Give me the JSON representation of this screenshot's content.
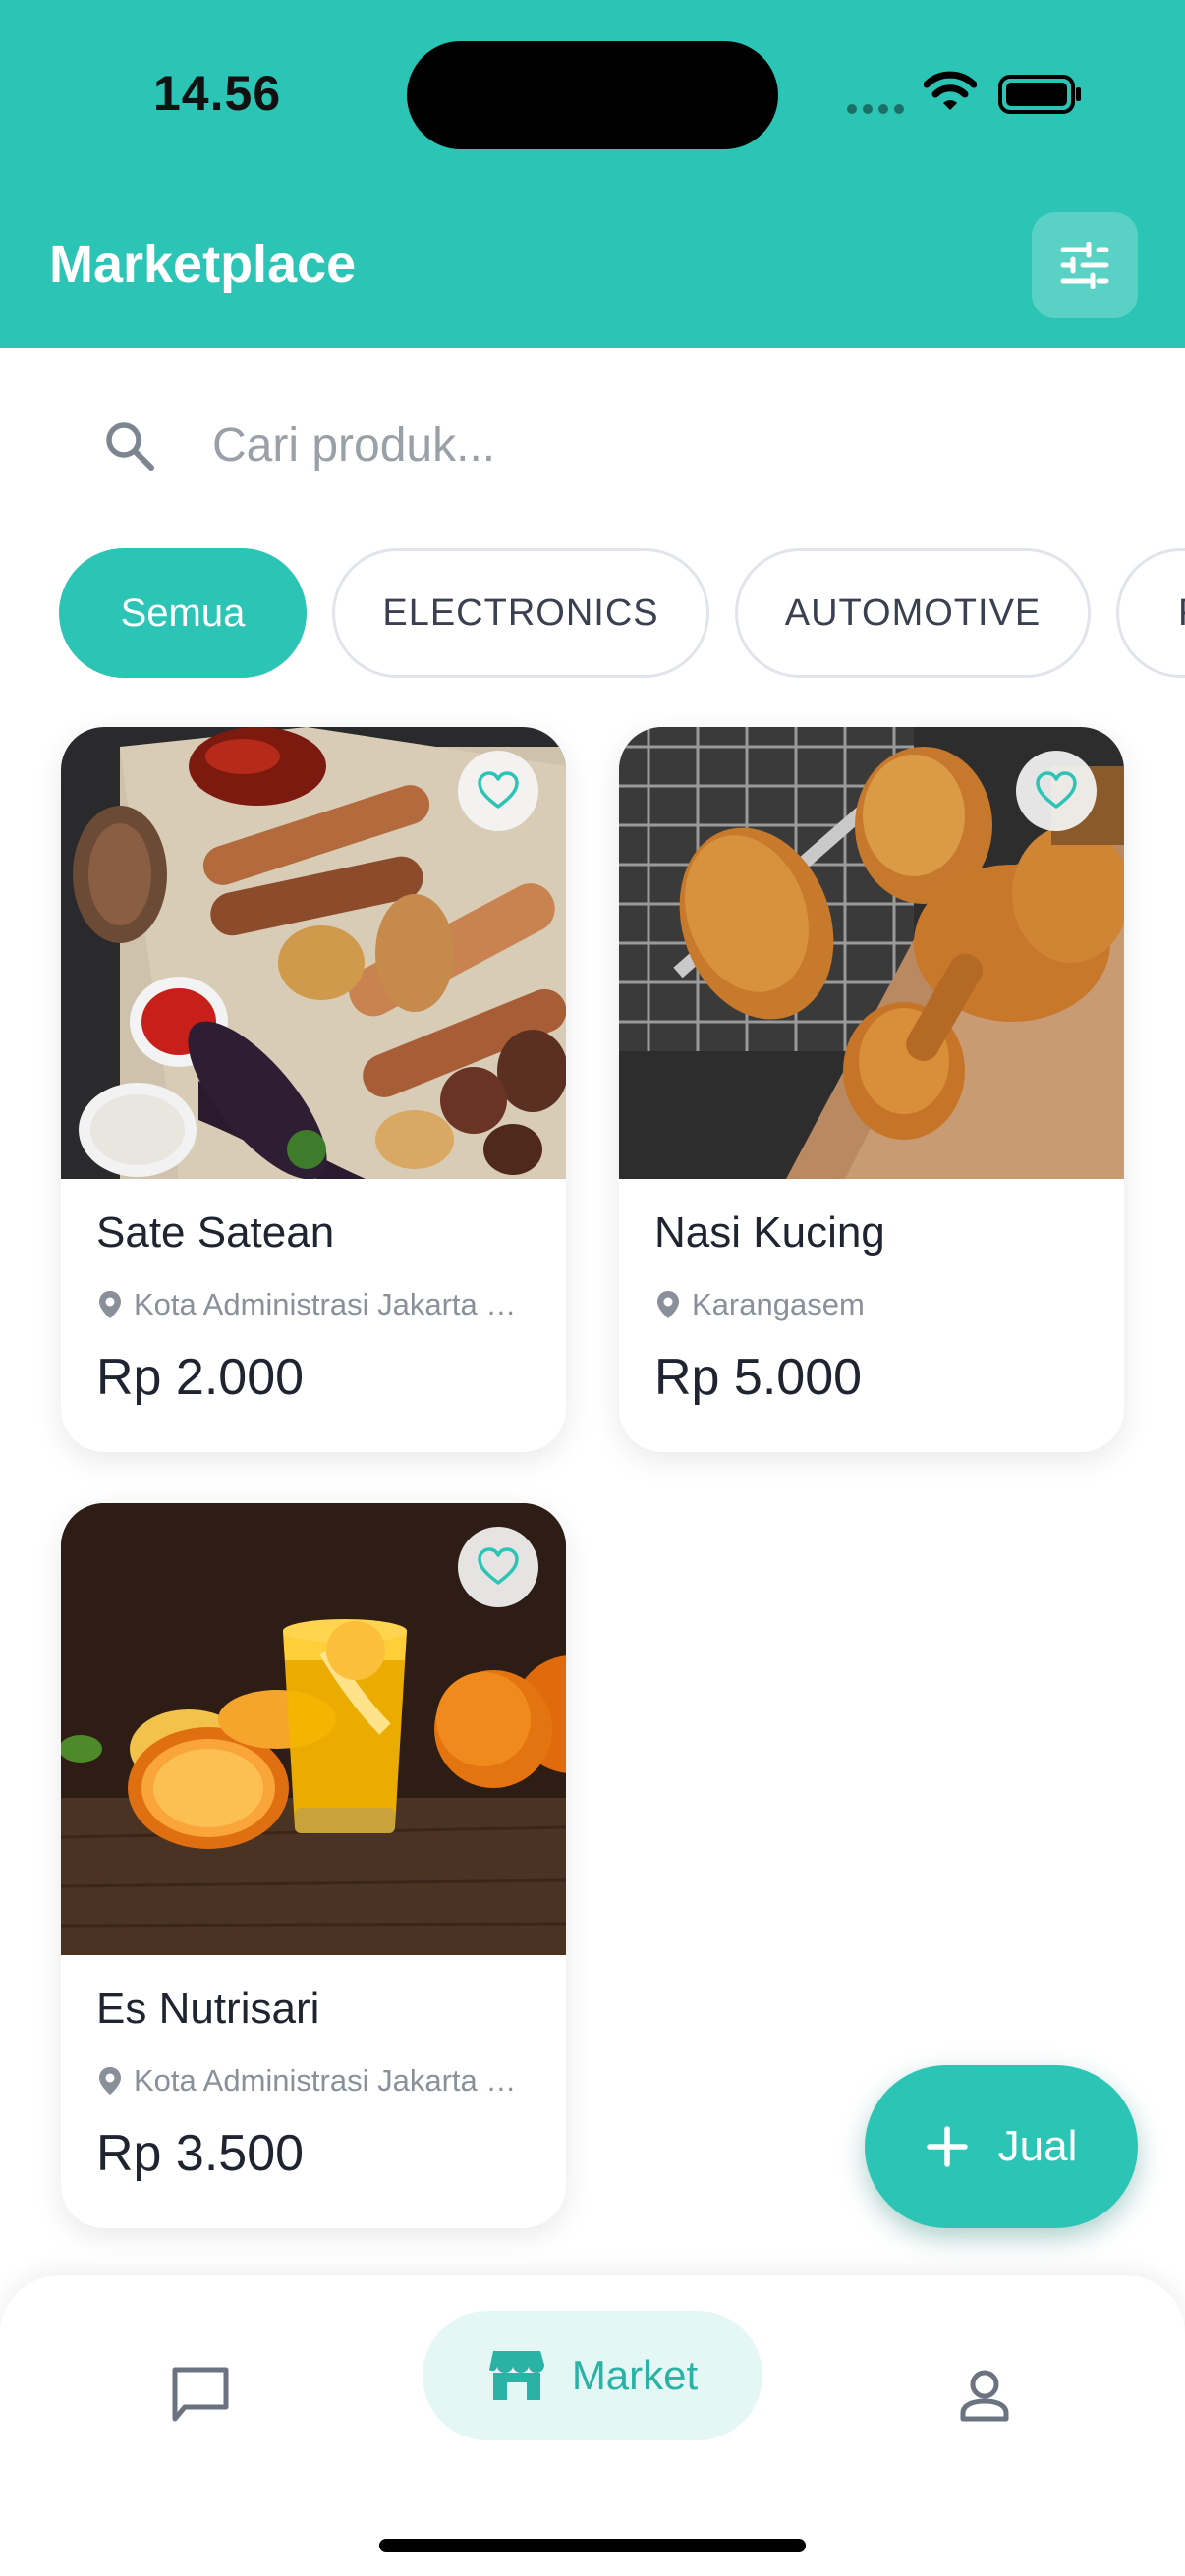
{
  "status_bar": {
    "time": "14.56"
  },
  "header": {
    "title": "Marketplace",
    "filter_icon": "sliders-icon"
  },
  "search": {
    "placeholder": "Cari produk...",
    "value": "",
    "icon": "search-icon"
  },
  "categories": [
    {
      "label": "Semua",
      "active": true
    },
    {
      "label": "ELECTRONICS",
      "active": false
    },
    {
      "label": "AUTOMOTIVE",
      "active": false
    },
    {
      "label": "F",
      "active": false
    }
  ],
  "products": [
    {
      "name": "Sate Satean",
      "location": "Kota Administrasi Jakarta Pusat",
      "price": "Rp 2.000"
    },
    {
      "name": "Nasi Kucing",
      "location": "Karangasem",
      "price": "Rp 5.000"
    },
    {
      "name": "Es Nutrisari",
      "location": "Kota Administrasi Jakarta Pusat",
      "price": "Rp 3.500"
    }
  ],
  "fab": {
    "label": "Jual",
    "icon": "plus-icon"
  },
  "bottom_nav": {
    "items": [
      {
        "icon": "chat-icon",
        "label": "",
        "active": false
      },
      {
        "icon": "store-icon",
        "label": "Market",
        "active": true
      },
      {
        "icon": "profile-icon",
        "label": "",
        "active": false
      }
    ]
  },
  "colors": {
    "primary": "#2cc4b5",
    "text": "#1f2430",
    "muted": "#8a9099"
  }
}
